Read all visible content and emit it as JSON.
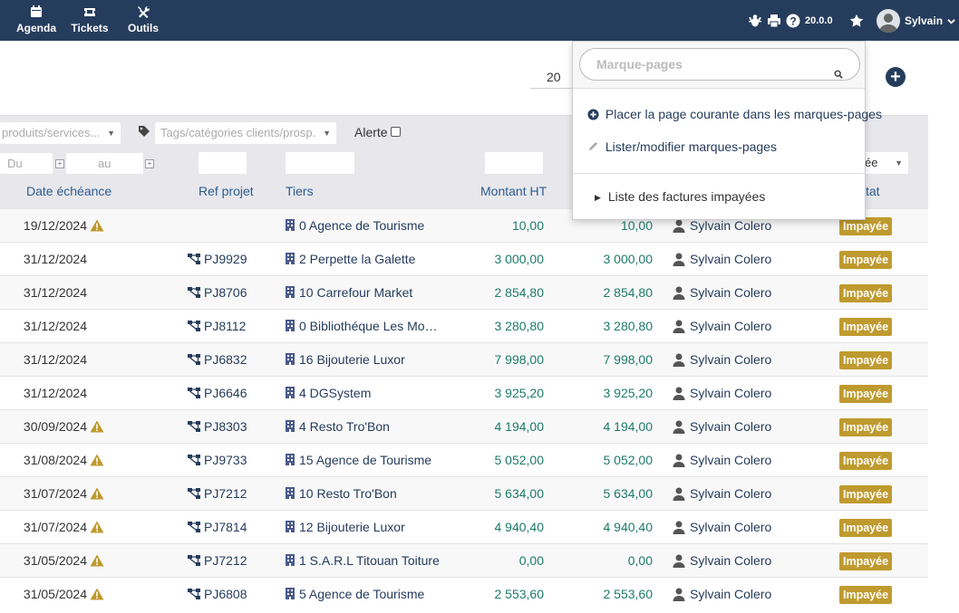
{
  "topnav": {
    "items": [
      {
        "label": "Agenda",
        "icon": "calendar-icon"
      },
      {
        "label": "Tickets",
        "icon": "ticket-icon"
      },
      {
        "label": "Outils",
        "icon": "tools-icon"
      }
    ],
    "version": "20.0.0",
    "user_name": "Sylvain"
  },
  "toolbar": {
    "limit": "20"
  },
  "filters": {
    "products_placeholder": "produits/services...",
    "tags_placeholder": "Tags/catégories clients/prosp.",
    "alert_label": "Alerte",
    "date_from": "Du",
    "date_to": "au",
    "status_select": "ée"
  },
  "columns": {
    "due_date": "Date échéance",
    "ref_project": "Ref projet",
    "tiers": "Tiers",
    "amount_ht": "Montant HT",
    "status": "tat"
  },
  "rows": [
    {
      "date": "19/12/2024",
      "warn": true,
      "project": "",
      "tiers": "0 Agence de Tourisme",
      "ht": "10,00",
      "ttc": "10,00",
      "user": "Sylvain Colero",
      "status": "Impayée"
    },
    {
      "date": "31/12/2024",
      "warn": false,
      "project": "PJ9929",
      "tiers": "2 Perpette la Galette",
      "ht": "3 000,00",
      "ttc": "3 000,00",
      "user": "Sylvain Colero",
      "status": "Impayée"
    },
    {
      "date": "31/12/2024",
      "warn": false,
      "project": "PJ8706",
      "tiers": "10 Carrefour Market",
      "ht": "2 854,80",
      "ttc": "2 854,80",
      "user": "Sylvain Colero",
      "status": "Impayée"
    },
    {
      "date": "31/12/2024",
      "warn": false,
      "project": "PJ8112",
      "tiers": "0 Bibliothéque Les Mou…",
      "ht": "3 280,80",
      "ttc": "3 280,80",
      "user": "Sylvain Colero",
      "status": "Impayée"
    },
    {
      "date": "31/12/2024",
      "warn": false,
      "project": "PJ6832",
      "tiers": "16 Bijouterie Luxor",
      "ht": "7 998,00",
      "ttc": "7 998,00",
      "user": "Sylvain Colero",
      "status": "Impayée"
    },
    {
      "date": "31/12/2024",
      "warn": false,
      "project": "PJ6646",
      "tiers": "4 DGSystem",
      "ht": "3 925,20",
      "ttc": "3 925,20",
      "user": "Sylvain Colero",
      "status": "Impayée"
    },
    {
      "date": "30/09/2024",
      "warn": true,
      "project": "PJ8303",
      "tiers": "4 Resto Tro'Bon",
      "ht": "4 194,00",
      "ttc": "4 194,00",
      "user": "Sylvain Colero",
      "status": "Impayée"
    },
    {
      "date": "31/08/2024",
      "warn": true,
      "project": "PJ9733",
      "tiers": "15 Agence de Tourisme",
      "ht": "5 052,00",
      "ttc": "5 052,00",
      "user": "Sylvain Colero",
      "status": "Impayée"
    },
    {
      "date": "31/07/2024",
      "warn": true,
      "project": "PJ7212",
      "tiers": "10 Resto Tro'Bon",
      "ht": "5 634,00",
      "ttc": "5 634,00",
      "user": "Sylvain Colero",
      "status": "Impayée"
    },
    {
      "date": "31/07/2024",
      "warn": true,
      "project": "PJ7814",
      "tiers": "12 Bijouterie Luxor",
      "ht": "4 940,40",
      "ttc": "4 940,40",
      "user": "Sylvain Colero",
      "status": "Impayée"
    },
    {
      "date": "31/05/2024",
      "warn": true,
      "project": "PJ7212",
      "tiers": "1 S.A.R.L Titouan Toiture",
      "ht": "0,00",
      "ttc": "0,00",
      "user": "Sylvain Colero",
      "status": "Impayée"
    },
    {
      "date": "31/05/2024",
      "warn": true,
      "project": "PJ6808",
      "tiers": "5 Agence de Tourisme",
      "ht": "2 553,60",
      "ttc": "2 553,60",
      "user": "Sylvain Colero",
      "status": "Impayée"
    }
  ],
  "bookmarks": {
    "search_placeholder": "Marque-pages",
    "add_current": "Placer la page courante dans les marques-pages",
    "edit_list": "Lister/modifier marques-pages",
    "saved": [
      "Liste des factures impayées"
    ]
  },
  "colors": {
    "topbar": "#263c5c",
    "badge": "#bf9a2e",
    "amount": "#1d7a6a",
    "link": "#263c5c"
  }
}
